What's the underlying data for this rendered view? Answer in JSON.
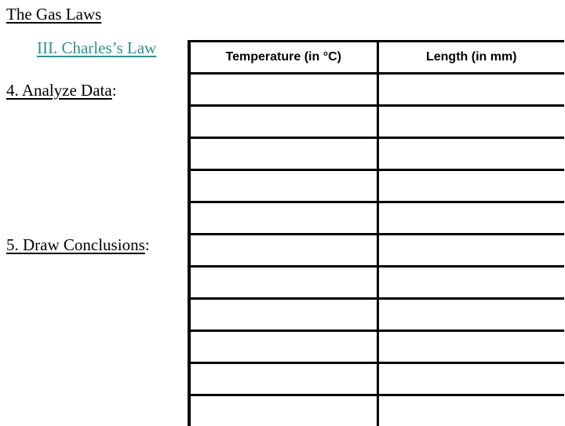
{
  "document": {
    "title": "The Gas Laws",
    "subtitle": "III.  Charles’s Law",
    "sections": [
      {
        "label": "4.  Analyze Data",
        "suffix": ":"
      },
      {
        "label": "5.  Draw Conclusions",
        "suffix": ":"
      }
    ]
  },
  "colors": {
    "subtitle": "#2f8f8f",
    "text": "#000000",
    "background": "#ffffff"
  },
  "table": {
    "headers": [
      "Temperature (in °C)",
      "Length (in mm)"
    ],
    "rows": [
      [
        "",
        ""
      ],
      [
        "",
        ""
      ],
      [
        "",
        ""
      ],
      [
        "",
        ""
      ],
      [
        "",
        ""
      ],
      [
        "",
        ""
      ],
      [
        "",
        ""
      ],
      [
        "",
        ""
      ],
      [
        "",
        ""
      ],
      [
        "",
        ""
      ],
      [
        "",
        ""
      ]
    ]
  }
}
